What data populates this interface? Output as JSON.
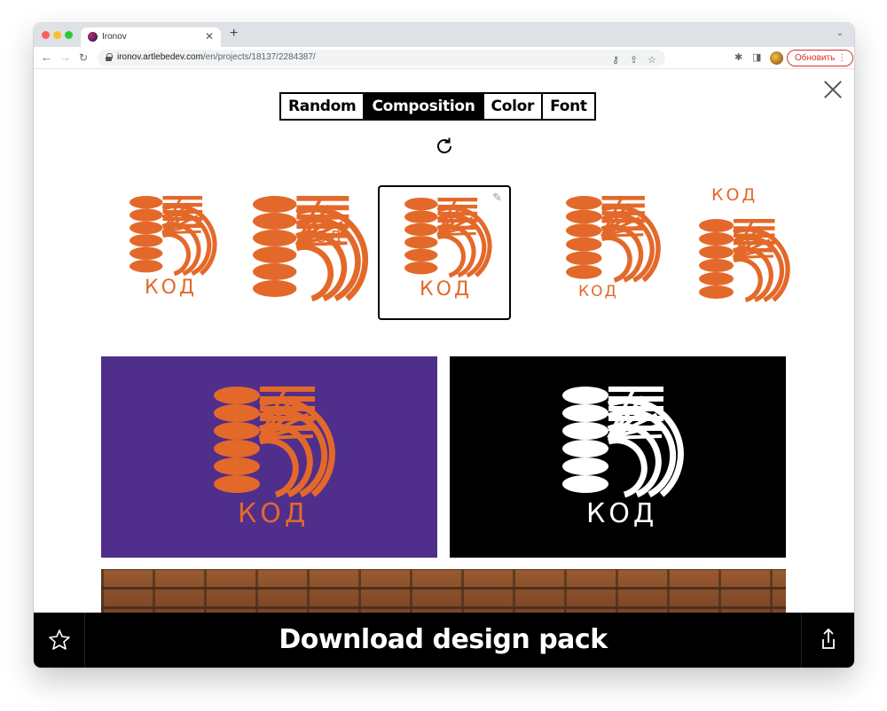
{
  "browser": {
    "tab_title": "Ironov",
    "url_host": "ironov.artlebedev.com",
    "url_path": "/en/projects/18137/2284387/",
    "update_label": "Обновить"
  },
  "tabs": [
    {
      "label": "Random"
    },
    {
      "label": "Composition"
    },
    {
      "label": "Color"
    },
    {
      "label": "Font"
    }
  ],
  "active_tab": "Composition",
  "logo_word": "КОД",
  "colors": {
    "orange": "#e3692a",
    "purple": "#4f2e8c",
    "black": "#000000",
    "white": "#ffffff"
  },
  "variants": [
    {
      "id": "v1",
      "layout": "word-below"
    },
    {
      "id": "v2",
      "layout": "word-overlay"
    },
    {
      "id": "v3",
      "layout": "word-below",
      "selected": true
    },
    {
      "id": "v4",
      "layout": "word-below-small"
    },
    {
      "id": "v5",
      "layout": "word-above"
    }
  ],
  "previews": [
    {
      "background": "#4f2e8c",
      "mark_color": "#e3692a"
    },
    {
      "background": "#000000",
      "mark_color": "#ffffff"
    }
  ],
  "bottom": {
    "download_label": "Download design pack",
    "star_icon": "star-icon",
    "share_icon": "share-icon"
  }
}
